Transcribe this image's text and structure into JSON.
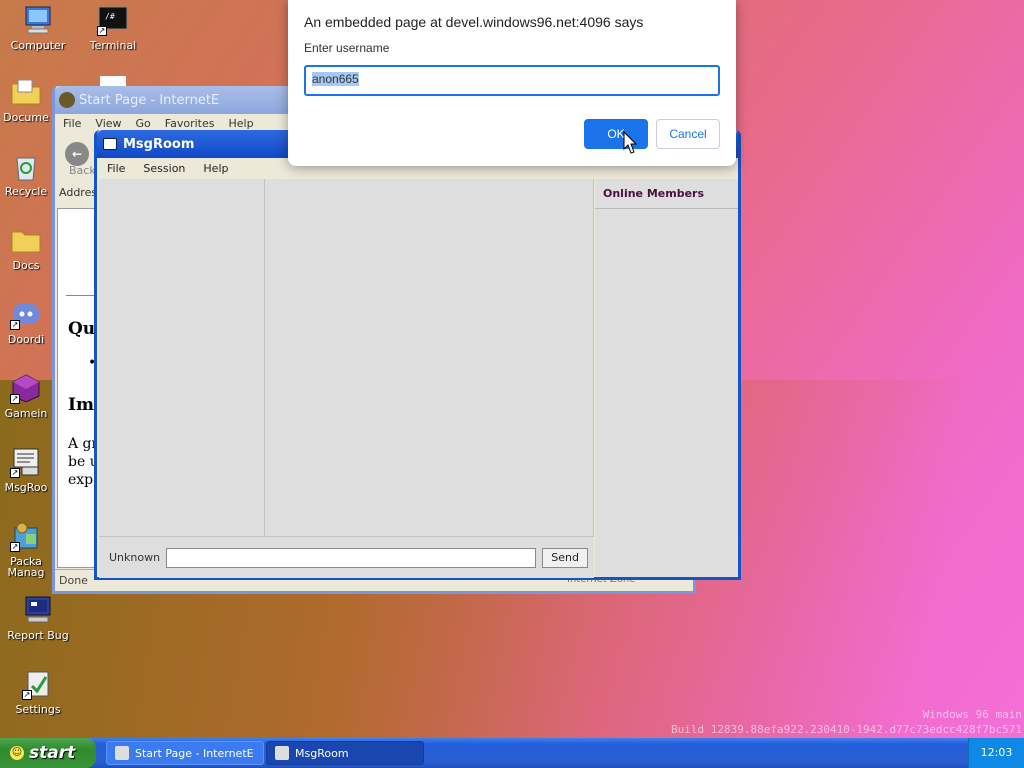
{
  "desktop": {
    "icons": [
      {
        "label": "Computer"
      },
      {
        "label": "Terminal"
      },
      {
        "label": "Docume"
      },
      {
        "label": "Recycle"
      },
      {
        "label": "Docs"
      },
      {
        "label": "Doordi"
      },
      {
        "label": "Gamein"
      },
      {
        "label": "MsgRoo"
      },
      {
        "label": "Packa"
      },
      {
        "label": "Manag"
      },
      {
        "label": "Report Bug"
      },
      {
        "label": "Settings"
      }
    ],
    "watermark_line1": "Windows 96 main",
    "watermark_line2": "Build 12839.88efa922.230410-1942.d77c73edcc428f7bc571"
  },
  "ie_window": {
    "title": "Start Page - InternetE",
    "menu": [
      "File",
      "View",
      "Go",
      "Favorites",
      "Help"
    ],
    "back_label": "Back",
    "address_label": "Address",
    "heading1": "Qui",
    "bullet": "•",
    "heading2": "Imp",
    "para_line1": "A gr",
    "para_line2": "be us",
    "para_line3": "expe",
    "status": "Done",
    "zone": "Internet Zone"
  },
  "msgroom": {
    "title": "MsgRoom",
    "menu": [
      "File",
      "Session",
      "Help"
    ],
    "online_members_title": "Online Members",
    "user_label": "Unknown",
    "send_label": "Send"
  },
  "dialog": {
    "title": "An embedded page at devel.windows96.net:4096 says",
    "prompt": "Enter username",
    "value": "anon665",
    "ok_label": "OK",
    "cancel_label": "Cancel",
    "accent_color": "#1a73e8"
  },
  "taskbar": {
    "start_label": "start",
    "tasks": [
      {
        "label": "Start Page - InternetE"
      },
      {
        "label": "MsgRoom"
      }
    ],
    "clock": "12:03"
  }
}
